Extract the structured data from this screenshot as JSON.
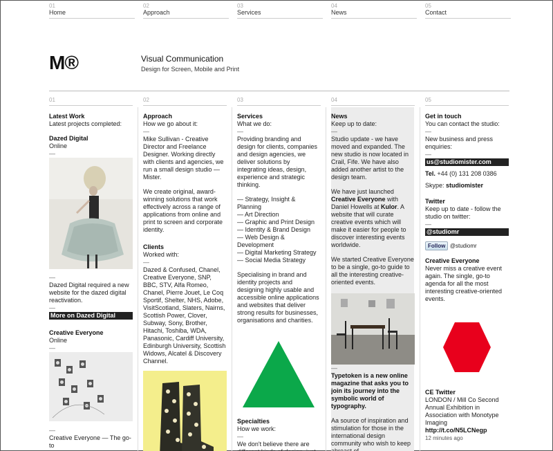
{
  "nav": [
    {
      "num": "01",
      "label": "Home"
    },
    {
      "num": "02",
      "label": "Approach"
    },
    {
      "num": "03",
      "label": "Services"
    },
    {
      "num": "04",
      "label": "News"
    },
    {
      "num": "05",
      "label": "Contact"
    }
  ],
  "brand": {
    "logo": "M®",
    "title": "Visual Communication",
    "subtitle": "Design for Screen, Mobile and Print"
  },
  "col1": {
    "num": "01",
    "heading": "Latest Work",
    "intro": "Latest projects completed:",
    "item1_title": "Dazed Digital",
    "item1_sub": "Online",
    "item1_desc": "Dazed Digital required a new website for the dazed digital reactivation.",
    "item1_link": "More on Dazed Digital",
    "item2_title": "Creative Everyone",
    "item2_sub": "Online",
    "item2_desc": "Creative Everyone — The go-to"
  },
  "col2": {
    "num": "02",
    "heading": "Approach",
    "intro": "How we go about it:",
    "p1": "Mike Sullivan - Creative Director and Freelance Designer. Working directly with clients and agencies, we run a small design studio — Mister.",
    "p2": "We create original, award-winning solutions that work effectively across a range of applications from online and print to screen and corporate identity.",
    "clients_heading": "Clients",
    "clients_intro": "Worked with:",
    "clients_list": "Dazed & Confused, Chanel, Creative Everyone, SNP, BBC, STV, Alfa Romeo, Chanel, Pierre Jouet, Le Coq Sportif, Shelter, NHS, Adobe, VisitScotland, Slaters, Nairns, Scottish Power, Clover, Subway, Sony, Brother, Hitachi, Toshiba, WDA, Panasonic, Cardiff University, Edinburgh University, Scottish Widows, Alcatel & Discovery Channel."
  },
  "col3": {
    "num": "03",
    "heading": "Services",
    "intro": "What we do:",
    "p1": "Providing branding and design for clients, companies and design agencies, we deliver solutions by integrating ideas, design, experience and strategic thinking.",
    "services": [
      "— Strategy, Insight & Planning",
      "— Art Direction",
      "— Graphic and Print Design",
      "— Identity & Brand Design",
      "— Web Design & Development",
      "— Digital Marketing Strategy",
      "— Social Media Strategy"
    ],
    "p2": "Specialising in brand and identity projects and designing highly usable and accessible online applications and websites that deliver strong results for businesses, organisations and charities.",
    "specialties_heading": "Specialties",
    "specialties_intro": "How we work:",
    "p3": "We don't believe there are different kinds of design, just different applications. This",
    "triangle_color": "#0ba84a"
  },
  "col4": {
    "num": "04",
    "heading": "News",
    "intro": "Keep up to date:",
    "p1": "Studio update - we have moved and expanded. The new studio is now located in Crail, Fife. We have also added another artist to the design team.",
    "p2_a": "We have just launched ",
    "p2_b": "Creative Everyone",
    "p2_c": " with Daniel Howells at ",
    "p2_d": "Kulor",
    "p2_e": ". A website that will curate creative events which will make it easier for people to discover interesting events worldwide.",
    "p3": "We started Creative Everyone to be a single, go-to guide to all the interesting creative-oriented events.",
    "p4": "Typetoken is a new online magazine that asks you to join its journey into the symbolic world of typography.",
    "p5": "Aa source of inspiration and stimulation for those in the international design community who wish to keep abreast of"
  },
  "col5": {
    "num": "05",
    "heading": "Get in touch",
    "intro": "You can contact the studio:",
    "p1": "New business and press enquiries:",
    "email": "us@studiomister.com",
    "tel_label": "Tel.",
    "tel": "+44 (0) 131 208 0386",
    "skype_label": "Skype:",
    "skype": "studiomister",
    "twitter_heading": "Twitter",
    "twitter_intro": "Keep up to date - follow the studio on twitter:",
    "twitter_handle": "@studiomr",
    "follow_label": "Follow",
    "follow_handle": "@studiomr",
    "ce_heading": "Creative Everyone",
    "ce_desc": "Never miss a creative event again. The single, go-to agenda for all the most interesting creative-oriented events.",
    "ce_twitter_heading": "CE Twitter",
    "ce_tweet": "LONDON / Mill Co Second Annual Exhibition in Association with Monotype Imaging",
    "ce_tweet_link": "http://t.co/N5LCNegp",
    "ce_tweet_time": "12 minutes ago",
    "hexagon_color": "#e8001c"
  }
}
